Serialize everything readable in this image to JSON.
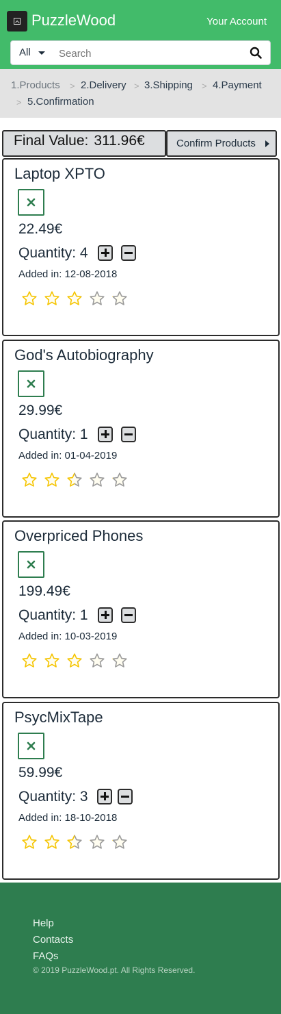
{
  "header": {
    "brand": "PuzzleWood",
    "account_link": "Your Account",
    "search": {
      "category": "All",
      "placeholder": "Search"
    }
  },
  "breadcrumb": [
    {
      "label": "1.Products",
      "active": false
    },
    {
      "label": "2.Delivery",
      "active": true
    },
    {
      "label": "3.Shipping",
      "active": true
    },
    {
      "label": "4.Payment",
      "active": true
    },
    {
      "label": "5.Confirmation",
      "active": true
    }
  ],
  "summary": {
    "final_value_label": "Final Value:",
    "final_value_amount": "311.96€",
    "confirm_button": "Confirm Products"
  },
  "products": [
    {
      "title": "Laptop XPTO",
      "price": "22.49€",
      "quantity_label": "Quantity: 4",
      "added": "Added in: 12-08-2018",
      "rating": 3,
      "rating_max": 5
    },
    {
      "title": "God's Autobiography",
      "price": "29.99€",
      "quantity_label": "Quantity: 1",
      "added": "Added in: 01-04-2019",
      "rating": 2.5,
      "rating_max": 5
    },
    {
      "title": "Overpriced Phones",
      "price": "199.49€",
      "quantity_label": "Quantity: 1",
      "added": "Added in: 10-03-2019",
      "rating": 3,
      "rating_max": 5
    },
    {
      "title": "PsycMixTape",
      "price": "59.99€",
      "quantity_label": "Quantity: 3",
      "added": "Added in: 18-10-2018",
      "rating": 2.5,
      "rating_max": 5
    }
  ],
  "footer": {
    "links": [
      "Help",
      "Contacts",
      "FAQs"
    ],
    "copyright": "© 2019 PuzzleWood.pt. All Rights Reserved."
  },
  "colors": {
    "navbar": "#42bb6a",
    "footer": "#2e7d4f",
    "star_filled": "#f5c400",
    "star_empty": "#9a9a9a"
  }
}
